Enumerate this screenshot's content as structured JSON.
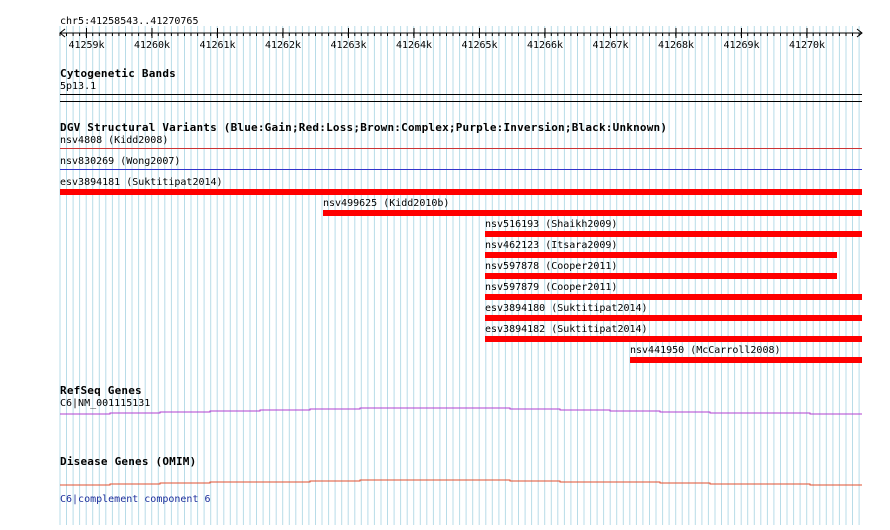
{
  "ruler": {
    "range_label": "chr5:41258543..41270765",
    "ticks": [
      "41259k",
      "41260k",
      "41261k",
      "41262k",
      "41263k",
      "41264k",
      "41265k",
      "41266k",
      "41267k",
      "41268k",
      "41269k",
      "41270k"
    ]
  },
  "tracks": {
    "cytobands": {
      "title": "Cytogenetic Bands",
      "band": "5p13.1"
    },
    "dgv": {
      "title": "DGV Structural Variants (Blue:Gain;Red:Loss;Brown:Complex;Purple:Inversion;Black:Unknown)",
      "variants": [
        {
          "label": "nsv4808 (Kidd2008)",
          "color": "#cc3333"
        },
        {
          "label": "nsv830269 (Wong2007)",
          "color": "#3333cc"
        },
        {
          "label": "esv3894181 (Suktitipat2014)",
          "color": "#ff0000"
        },
        {
          "label": "nsv499625 (Kidd2010b)",
          "color": "#ff0000"
        },
        {
          "label": "nsv516193 (Shaikh2009)",
          "color": "#ff0000"
        },
        {
          "label": "nsv462123 (Itsara2009)",
          "color": "#ff0000"
        },
        {
          "label": "nsv597878 (Cooper2011)",
          "color": "#ff0000"
        },
        {
          "label": "nsv597879 (Cooper2011)",
          "color": "#ff0000"
        },
        {
          "label": "esv3894180 (Suktitipat2014)",
          "color": "#ff0000"
        },
        {
          "label": "esv3894182 (Suktitipat2014)",
          "color": "#ff0000"
        },
        {
          "label": "nsv441950 (McCarroll2008)",
          "color": "#ff0000"
        }
      ]
    },
    "refseq": {
      "title": "RefSeq Genes",
      "gene": "C6|NM_001115131",
      "color": "#b040d0"
    },
    "omim": {
      "title": "Disease Genes (OMIM)",
      "gene": "C6|complement component 6",
      "color": "#e05030"
    }
  }
}
